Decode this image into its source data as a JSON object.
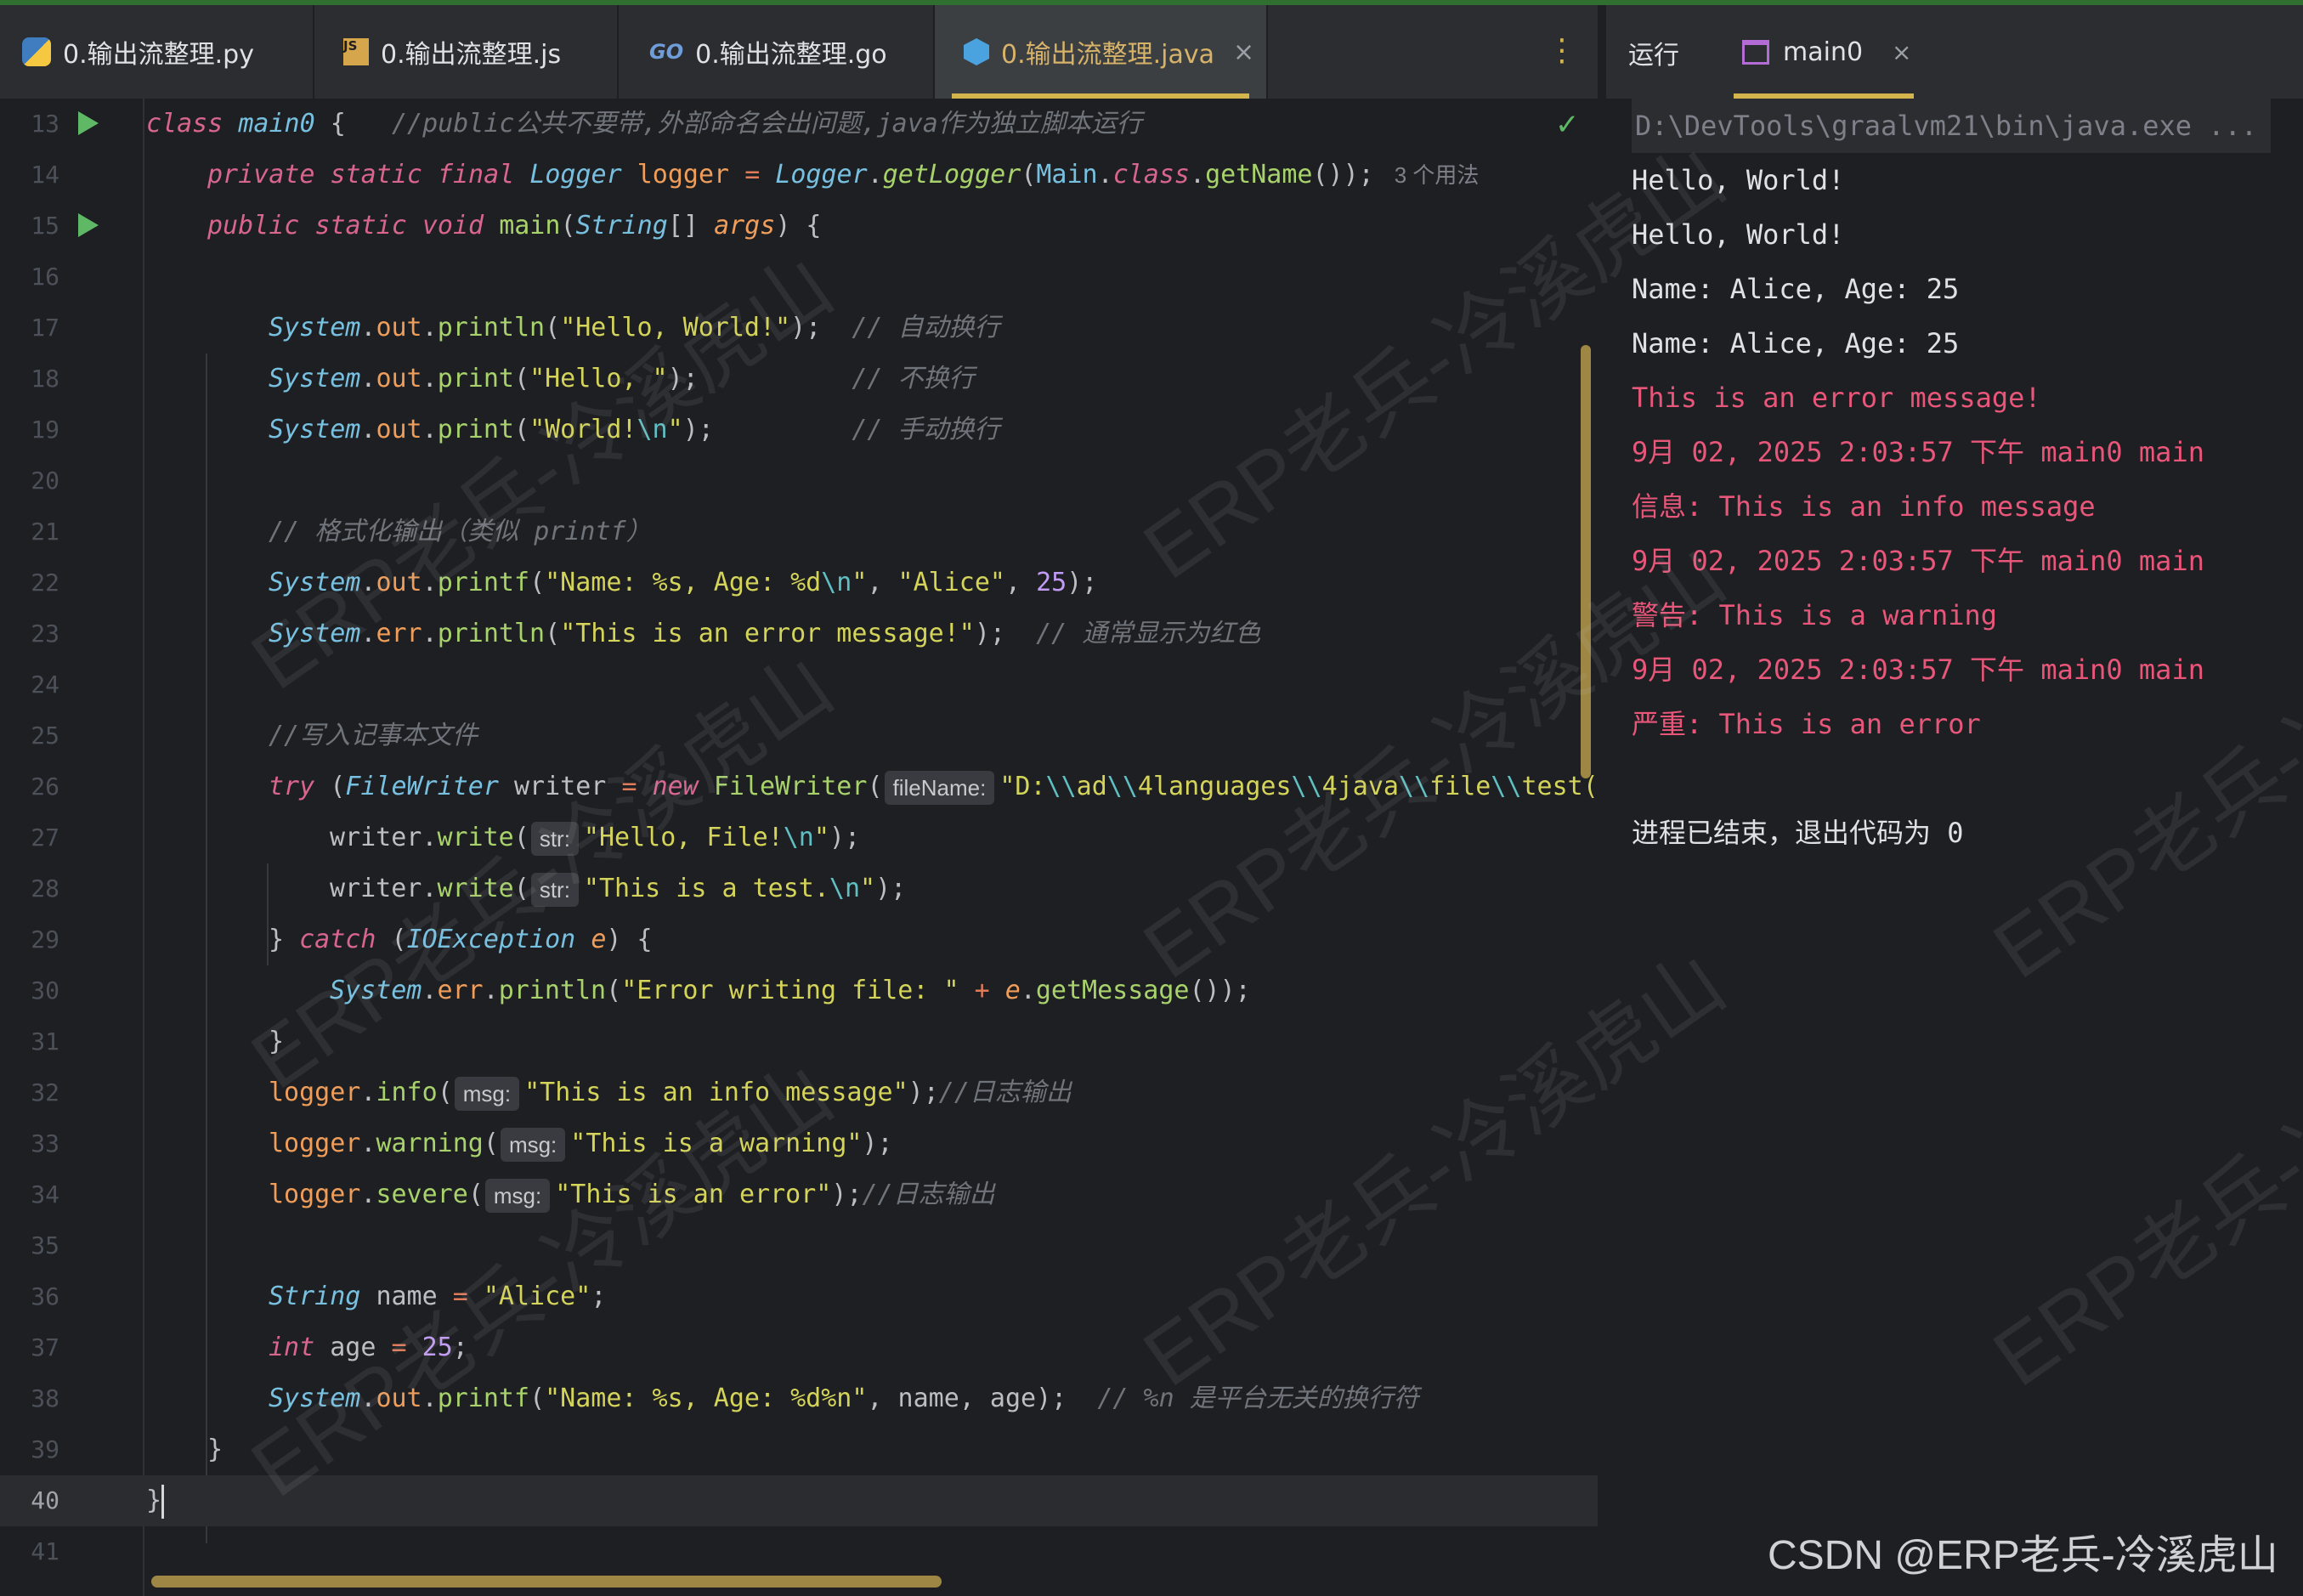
{
  "editor_tabs": [
    {
      "label": "0.输出流整理.py",
      "icon": "python-file-icon"
    },
    {
      "label": "0.输出流整理.js",
      "icon": "js-file-icon"
    },
    {
      "label": "0.输出流整理.go",
      "icon": "go-file-icon"
    },
    {
      "label": "0.输出流整理.java",
      "icon": "java-file-icon",
      "active": true
    }
  ],
  "run_panel": {
    "title": "运行",
    "tab_label": "main0"
  },
  "code": {
    "l13": {
      "kw": "class",
      "cls": "main0",
      "brace": "{",
      "comment": "//public公共不要带,外部命名会出问题,java作为独立脚本运行"
    },
    "l14": {
      "kw1": "private",
      "kw2": "static",
      "kw3": "final",
      "type": "Logger",
      "field": "logger",
      "eq": "=",
      "cls": "Logger",
      "m": "getLogger",
      "arg1": "Main",
      "kw4": "class",
      "m2": "getName",
      "tail": "());",
      "usages": "3 个用法"
    },
    "l15": {
      "kw1": "public",
      "kw2": "static",
      "kw3": "void",
      "name": "main",
      "type": "String",
      "brackets": "[]",
      "param": "args",
      "tail": ") {"
    },
    "l17": {
      "str": "\"Hello, World!\"",
      "comment": "// 自动换行"
    },
    "l18": {
      "str": "\"Hello, \"",
      "comment": "// 不换行"
    },
    "l19": {
      "str": "\"World!",
      "esc": "\\n",
      "strend": "\"",
      "comment": "// 手动换行"
    },
    "l21": {
      "comment": "// 格式化输出（类似 printf）"
    },
    "l22": {
      "str1": "\"Name: %s, Age: %d",
      "esc": "\\n",
      "strend": "\"",
      "str2": "\"Alice\"",
      "num": "25"
    },
    "l23": {
      "str": "\"This is an error message!\"",
      "comment": "// 通常显示为红色"
    },
    "l25": {
      "comment": "//写入记事本文件"
    },
    "l26": {
      "kw": "try",
      "type": "FileWriter",
      "var": "writer",
      "kw2": "new",
      "cls": "FileWriter",
      "hint": "fileName:",
      "s1": "\"D:",
      "e1": "\\\\",
      "s2": "ad",
      "e2": "\\\\",
      "s3": "4languages",
      "e3": "\\\\",
      "s4": "4java",
      "e4": "\\\\",
      "s5": "file",
      "e5": "\\\\",
      "s6": "test("
    },
    "l27": {
      "obj": "writer",
      "m": "write",
      "hint": "str:",
      "str": "\"Hello, File!",
      "esc": "\\n",
      "strend": "\""
    },
    "l28": {
      "obj": "writer",
      "m": "write",
      "hint": "str:",
      "str": "\"This is a test.",
      "esc": "\\n",
      "strend": "\""
    },
    "l29": {
      "brace": "}",
      "kw": "catch",
      "type": "IOException",
      "var": "e",
      "tail": ") {"
    },
    "l30": {
      "str": "\"Error writing file: \"",
      "op": "+",
      "var": "e",
      "m": "getMessage",
      "tail": "());"
    },
    "l31": {
      "brace": "}"
    },
    "l32": {
      "m": "info",
      "hint": "msg:",
      "str": "\"This is an info message\"",
      "comment": "//日志输出"
    },
    "l33": {
      "m": "warning",
      "hint": "msg:",
      "str": "\"This is a warning\""
    },
    "l34": {
      "m": "severe",
      "hint": "msg:",
      "str": "\"This is an error\"",
      "comment": "//日志输出"
    },
    "l36": {
      "type": "String",
      "var": "name",
      "eq": "=",
      "str": "\"Alice\""
    },
    "l37": {
      "type": "int",
      "var": "age",
      "eq": "=",
      "num": "25"
    },
    "l38": {
      "str": "\"Name: %s, Age: %d%n\"",
      "a1": "name",
      "a2": "age",
      "comment": "// %n 是平台无关的换行符"
    },
    "l39": {
      "brace": "}"
    },
    "l40": {
      "brace": "}"
    },
    "sys": "System",
    "out": "out",
    "err": "err",
    "println": "println",
    "print": "print",
    "printf": "printf",
    "logger": "logger"
  },
  "line_numbers": [
    "13",
    "14",
    "15",
    "16",
    "17",
    "18",
    "19",
    "20",
    "21",
    "22",
    "23",
    "24",
    "25",
    "26",
    "27",
    "28",
    "29",
    "30",
    "31",
    "32",
    "33",
    "34",
    "35",
    "36",
    "37",
    "38",
    "39",
    "40",
    "41"
  ],
  "console": {
    "command": "D:\\DevTools\\graalvm21\\bin\\java.exe ...",
    "lines": [
      {
        "text": "Hello, World!",
        "kind": "out"
      },
      {
        "text": "Hello, World!",
        "kind": "out"
      },
      {
        "text": "Name: Alice, Age: 25",
        "kind": "out"
      },
      {
        "text": "Name: Alice, Age: 25",
        "kind": "out"
      },
      {
        "text": "This is an error message!",
        "kind": "err"
      },
      {
        "text": "9月 02, 2025 2:03:57 下午 main0 main",
        "kind": "err"
      },
      {
        "text": "信息: This is an info message",
        "kind": "err"
      },
      {
        "text": "9月 02, 2025 2:03:57 下午 main0 main",
        "kind": "err"
      },
      {
        "text": "警告: This is a warning",
        "kind": "err"
      },
      {
        "text": "9月 02, 2025 2:03:57 下午 main0 main",
        "kind": "err"
      },
      {
        "text": "严重: This is an error",
        "kind": "err"
      }
    ],
    "exit_text": "进程已结束，退出代码为 0"
  },
  "watermark": "CSDN @ERP老兵-冷溪虎山",
  "overlay_watermark": "ERP老兵-冷溪虎山",
  "colors": {
    "accent": "#d4b44c",
    "run_green": "#5fb865",
    "error_red": "#e8567a"
  }
}
